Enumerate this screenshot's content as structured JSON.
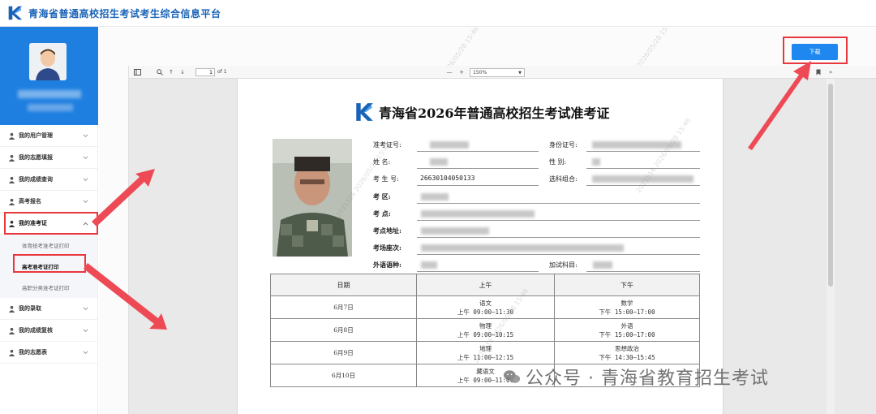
{
  "header": {
    "title": "青海省普通高校招生考试考生综合信息平台"
  },
  "sidebar": {
    "items": [
      {
        "label": "我的用户管理"
      },
      {
        "label": "我的志愿填报"
      },
      {
        "label": "我的成绩查询"
      },
      {
        "label": "高考报名"
      },
      {
        "label": "我的准考证"
      },
      {
        "label": "我的录取"
      },
      {
        "label": "我的成绩复核"
      },
      {
        "label": "我的志愿表"
      }
    ],
    "submenu": [
      {
        "label": "体育统考准考证打印"
      },
      {
        "label": "高考准考证打印"
      },
      {
        "label": "高职分类准考证打印"
      }
    ]
  },
  "toolbar": {
    "download_label": "下载"
  },
  "pdf": {
    "page_current": "1",
    "page_total": "of 1",
    "zoom": "150%",
    "icons": [
      "sidebar-toggle-icon",
      "search-icon",
      "arrow-up-icon",
      "arrow-down-icon",
      "zoom-out-icon",
      "zoom-in-icon",
      "print-icon",
      "bookmark-icon",
      "double-chevron-right-icon"
    ]
  },
  "certificate": {
    "title": "青海省2026年普通高校招生考试准考证",
    "labels": {
      "admission_no": "准考证号:",
      "id_no": "身份证号:",
      "name": "姓 名:",
      "gender": "性 别:",
      "exam_no": "考 生 号:",
      "subject_combo": "选科组合:",
      "district": "考 区:",
      "site": "考 点:",
      "site_address": "考点地址:",
      "room_seat": "考场座次:",
      "foreign_language": "外语语种:",
      "extra_subject": "加试科目:"
    },
    "exam_no_value": "26630104050133",
    "schedule": {
      "headers": [
        "日期",
        "上午",
        "下午"
      ],
      "rows": [
        {
          "date": "6月7日",
          "am_subject": "语文",
          "am_time": "上午 09:00—11:30",
          "pm_subject": "数学",
          "pm_time": "下午 15:00—17:00"
        },
        {
          "date": "6月8日",
          "am_subject": "物理",
          "am_time": "上午 09:00—10:15",
          "pm_subject": "外语",
          "pm_time": "下午 15:00—17:00"
        },
        {
          "date": "6月9日",
          "am_subject": "地理",
          "am_time": "上午 11:00—12:15",
          "pm_subject": "思想政治",
          "pm_time": "下午 14:30—15:45"
        },
        {
          "date": "6月10日",
          "am_subject": "藏语文",
          "am_time": "上午 09:00—11:00",
          "pm_subject": "",
          "pm_time": ""
        }
      ]
    }
  },
  "watermark": {
    "line1": "2021516",
    "line2": "2026/05/28 15:46"
  },
  "overlay": {
    "wechat_text": "公众号 · 青海省教育招生考试"
  },
  "colors": {
    "brand": "#1e7fe0",
    "highlight": "#e8383d",
    "button": "#1e88f0"
  }
}
